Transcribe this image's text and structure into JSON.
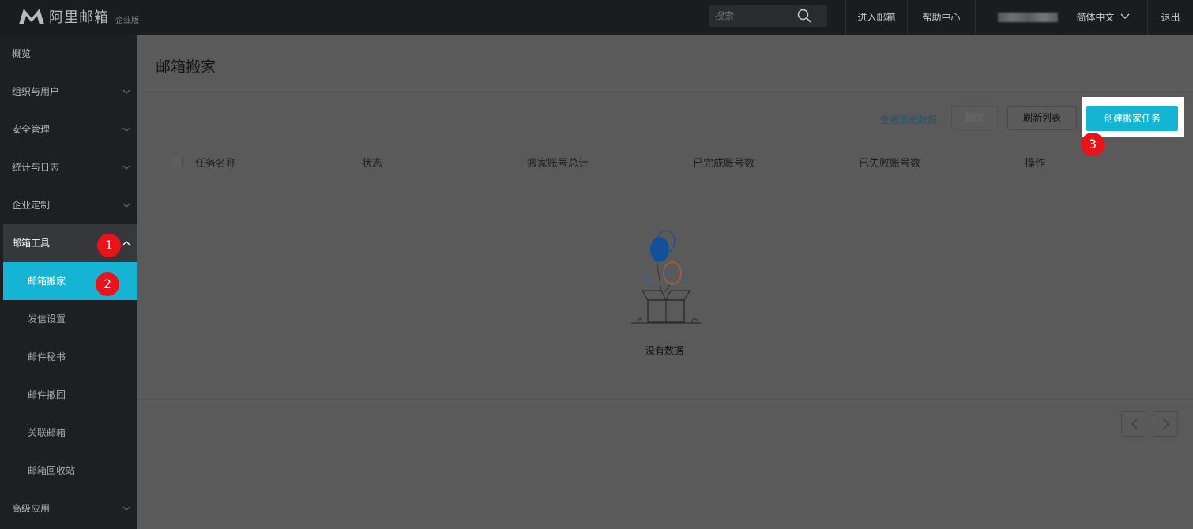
{
  "topbar": {
    "logo_text": "阿里邮箱",
    "logo_badge": "企业版",
    "search_placeholder": "搜索",
    "enter_mail": "进入邮箱",
    "help_center": "帮助中心",
    "language": "简体中文",
    "logout": "退出"
  },
  "sidebar": {
    "items": [
      {
        "label": "概览"
      },
      {
        "label": "组织与用户"
      },
      {
        "label": "安全管理"
      },
      {
        "label": "统计与日志"
      },
      {
        "label": "企业定制"
      },
      {
        "label": "邮箱工具"
      },
      {
        "label": "高级应用"
      }
    ],
    "sub_items": [
      {
        "label": "邮箱搬家"
      },
      {
        "label": "发信设置"
      },
      {
        "label": "邮件秘书"
      },
      {
        "label": "邮件撤回"
      },
      {
        "label": "关联邮箱"
      },
      {
        "label": "邮箱回收站"
      }
    ]
  },
  "main": {
    "title": "邮箱搬家",
    "history_link": "查看历史数据",
    "delete_button": "删除",
    "refresh_button": "刷新列表",
    "create_button": "创建搬家任务",
    "columns": [
      "任务名称",
      "状态",
      "搬家账号总计",
      "已完成账号数",
      "已失败账号数",
      "操作"
    ],
    "empty_text": "没有数据"
  },
  "annotations": {
    "step1": "1",
    "step2": "2",
    "step3": "3"
  },
  "colors": {
    "accent": "#16b4d4",
    "badge_red": "#e8141a",
    "topbar_bg": "#1b1c1e",
    "sidebar_bg": "#1e1f22"
  }
}
